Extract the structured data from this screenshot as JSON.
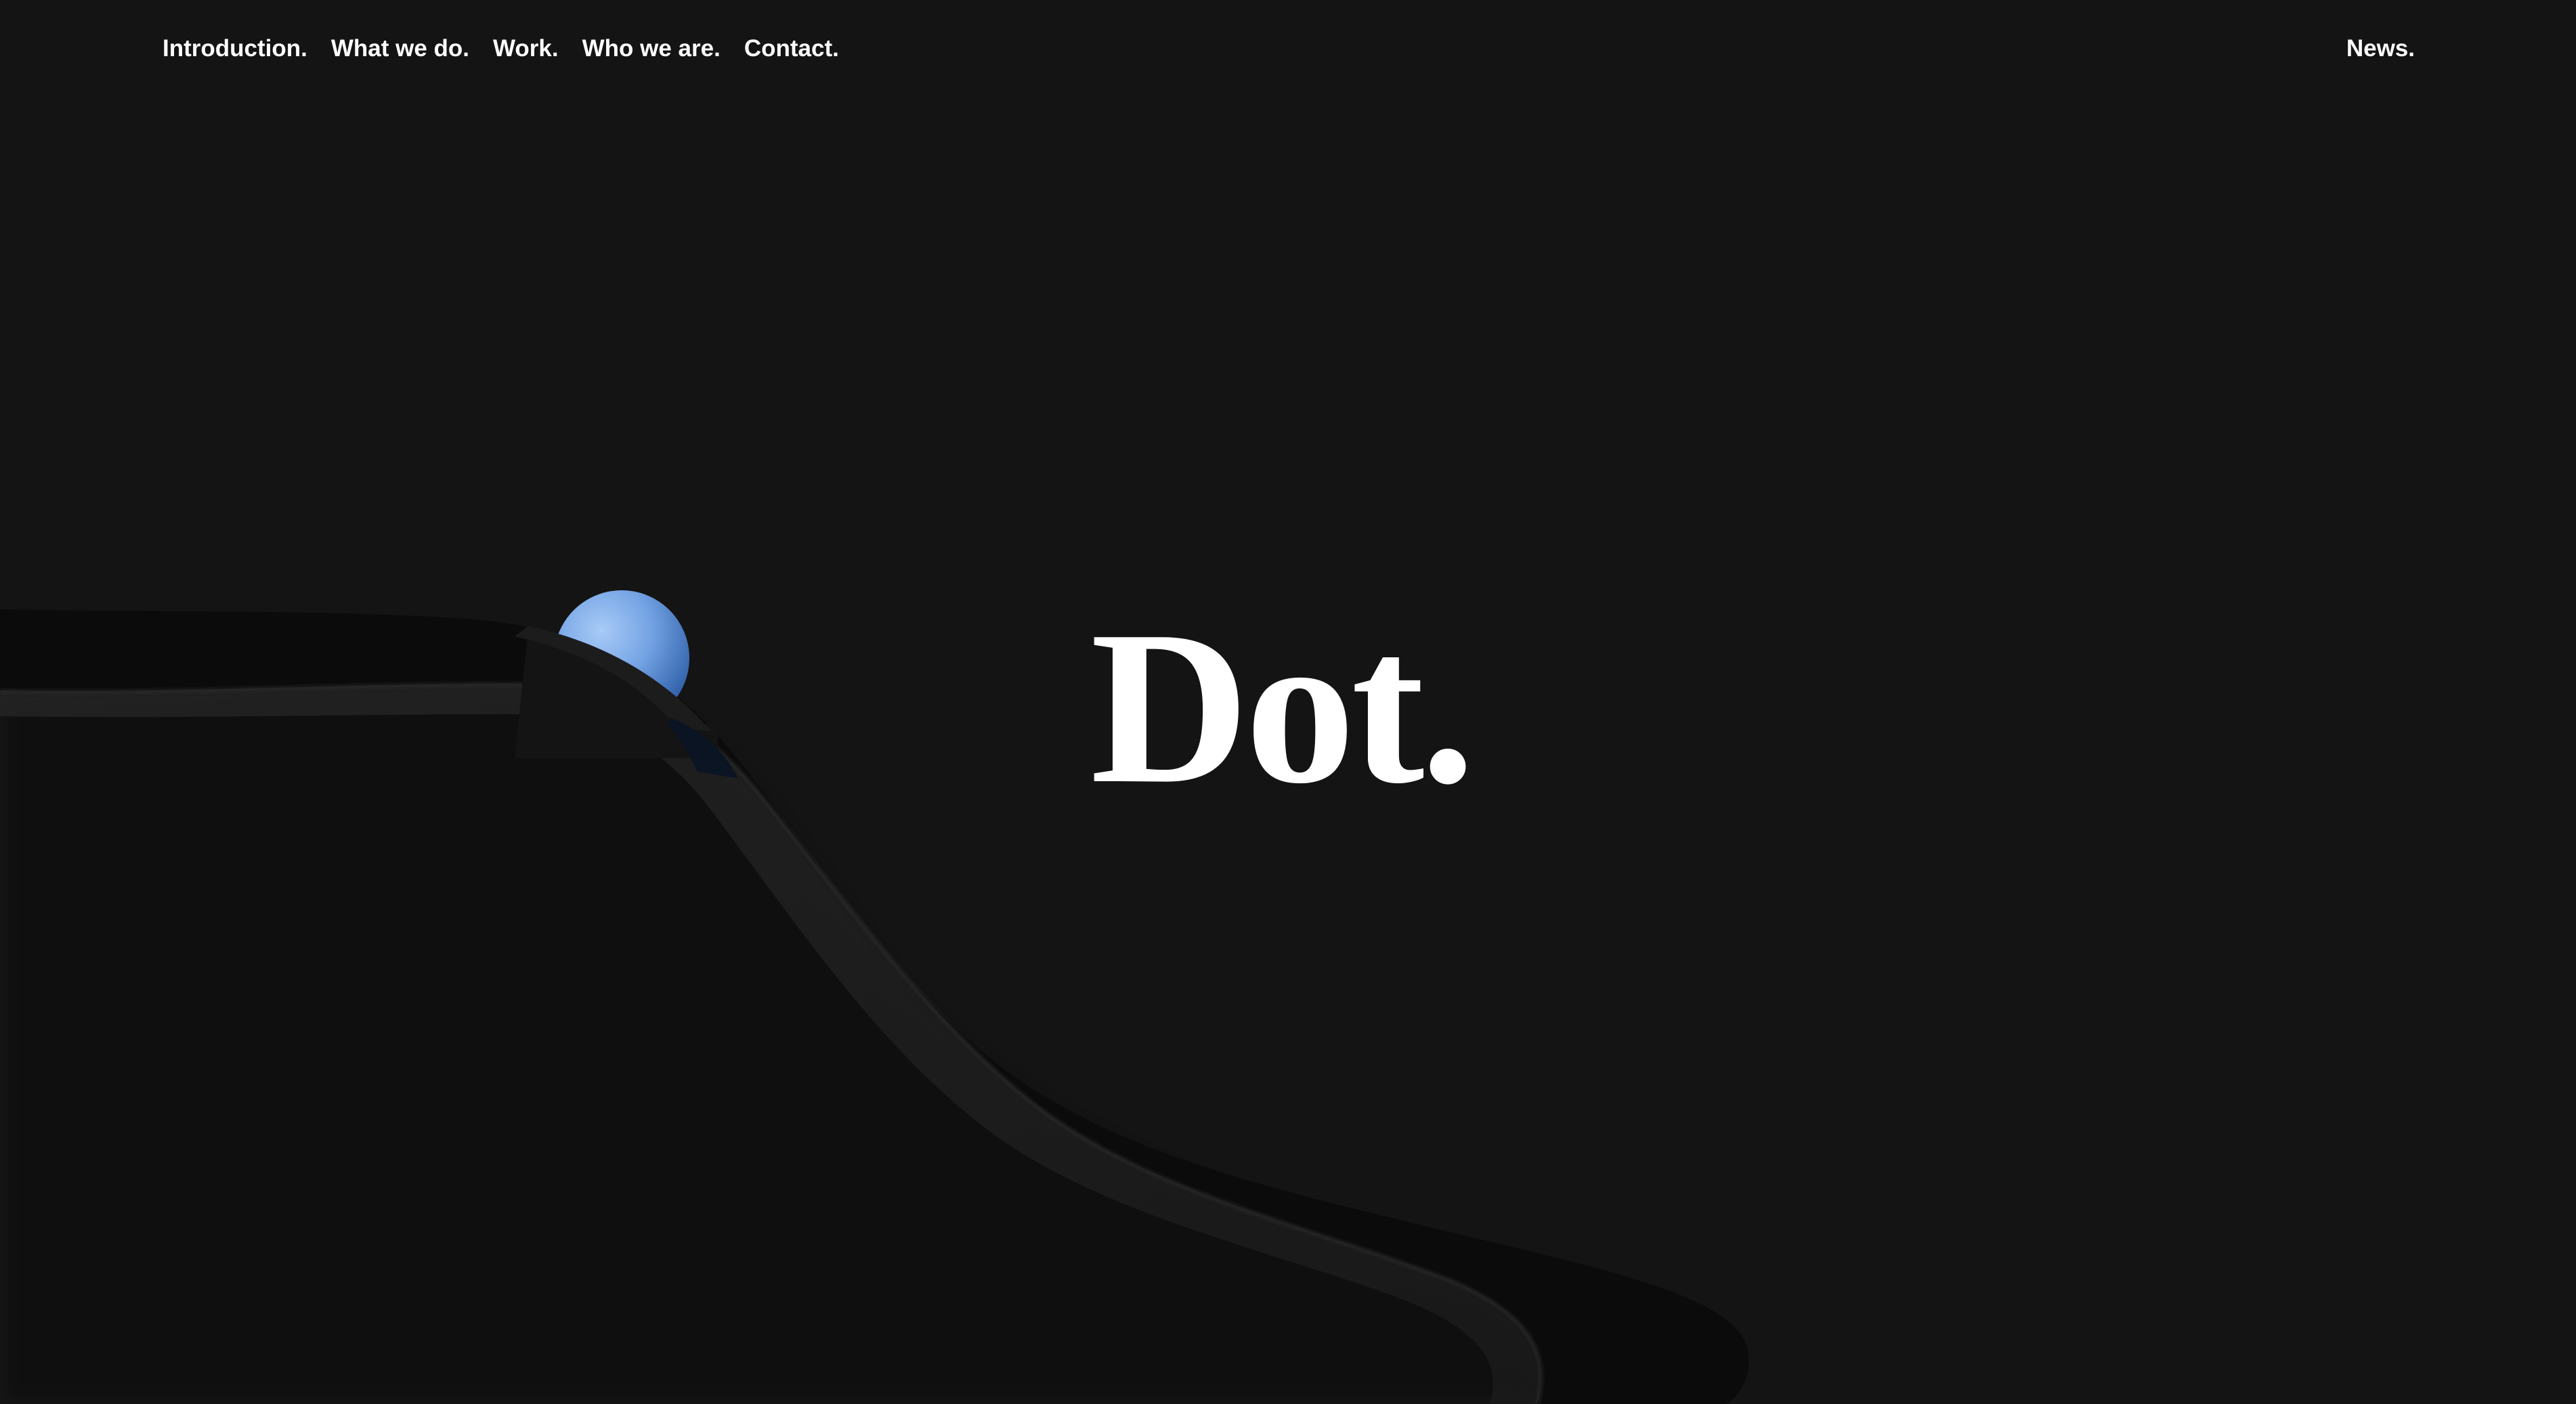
{
  "nav": {
    "items": [
      {
        "label": "Introduction."
      },
      {
        "label": "What we do."
      },
      {
        "label": "Work."
      },
      {
        "label": "Who we are."
      },
      {
        "label": "Contact."
      }
    ],
    "right": {
      "label": "News."
    }
  },
  "hero": {
    "logo_text": "Dot."
  },
  "colors": {
    "background": "#141414",
    "text": "#ffffff",
    "sphere": "#6f9ddf",
    "ribbon": "#0c0c0c"
  }
}
